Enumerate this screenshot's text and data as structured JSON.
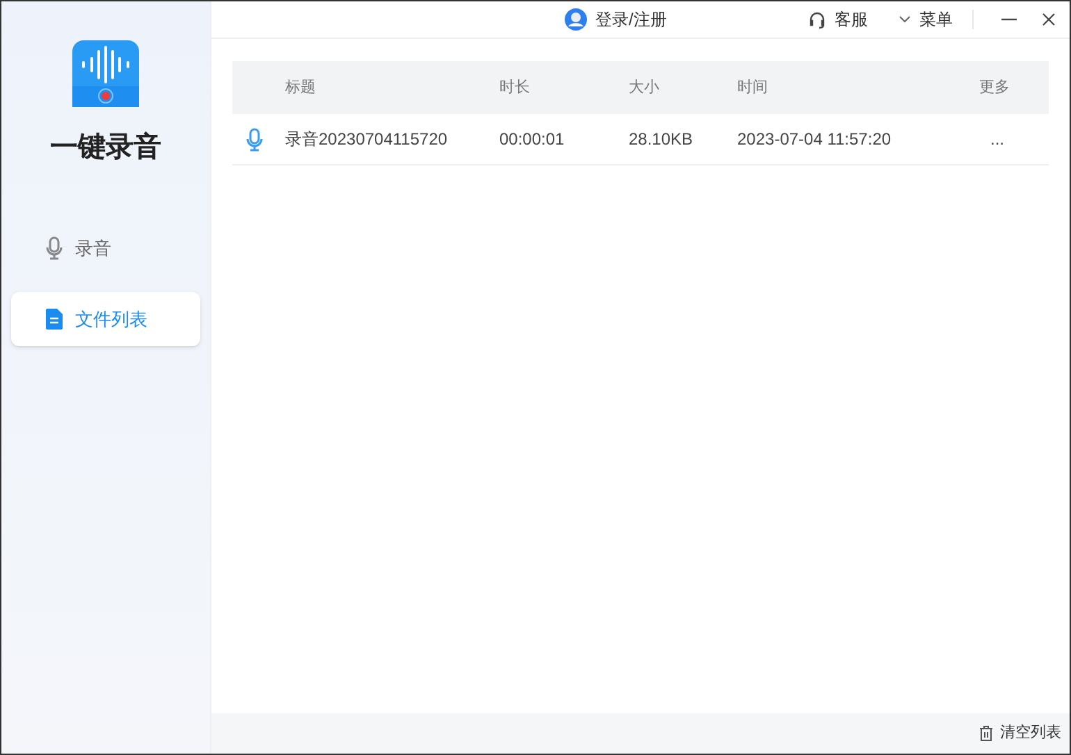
{
  "app": {
    "name": "一键录音"
  },
  "sidebar": {
    "items": [
      {
        "label": "录音",
        "kind": "mic",
        "selected": false
      },
      {
        "label": "文件列表",
        "kind": "file",
        "selected": true
      }
    ]
  },
  "top_bar": {
    "login": "登录/注册",
    "service": "客服",
    "menu": "菜单"
  },
  "table": {
    "columns": [
      "标题",
      "时长",
      "大小",
      "时间",
      "更多"
    ],
    "rows": [
      {
        "title": "录音20230704115720",
        "duration": "00:00:01",
        "size": "28.10KB",
        "time": "2023-07-04 11:57:20",
        "more": "..."
      }
    ]
  },
  "footer": {
    "clear": "清空列表"
  }
}
